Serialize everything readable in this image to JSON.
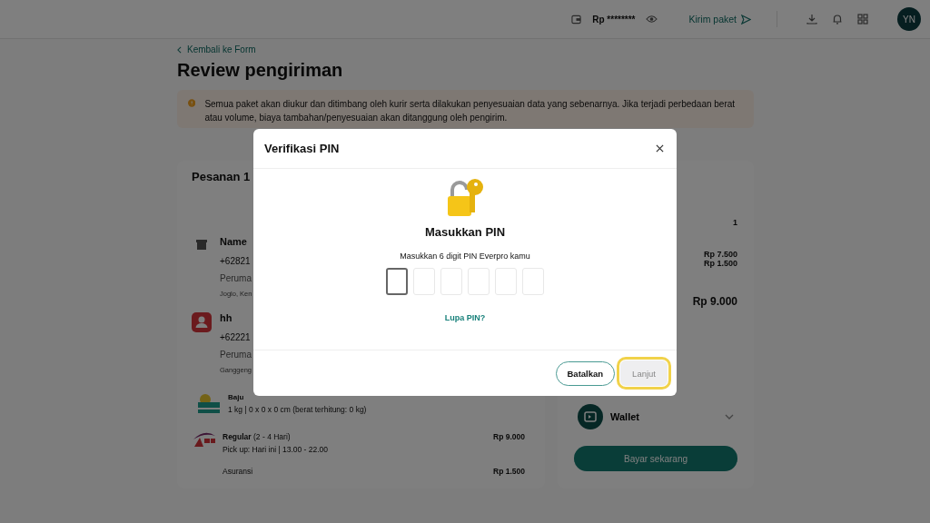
{
  "header": {
    "balance": "Rp ********",
    "send_button": "Kirim paket",
    "avatar": "YN"
  },
  "back_link": "Kembali ke Form",
  "page_title": "Review pengiriman",
  "notice": "Semua paket akan diukur dan ditimbang oleh kurir serta dilakukan penyesuaian data yang sebenarnya. Jika terjadi perbedaan berat atau volume, biaya tambahan/penyesuaian akan ditanggung oleh pengirim.",
  "order": {
    "title": "Pesanan 1",
    "sender": {
      "name": "Name",
      "phone": "+62821",
      "address": "Peruma",
      "area": "Joglo, Ken"
    },
    "receiver": {
      "name": "hh",
      "phone": "+62221",
      "address": "Peruma",
      "area": "Ganggeng"
    },
    "item": {
      "name": "Baju",
      "detail": "1 kg | 0 x 0 x 0 cm (berat terhitung: 0 kg)"
    },
    "courier": {
      "service": "Regular",
      "duration": "(2 - 4 Hari)",
      "pickup": "Pick up: Hari ini | 13.00 - 22.00",
      "price": "Rp 9.000"
    },
    "insurance": {
      "label": "Asuransi",
      "price": "Rp 1.500"
    }
  },
  "summary": {
    "values": [
      "1",
      "Rp 7.500",
      "Rp 1.500"
    ],
    "total": "Rp 9.000",
    "payment_method": "Wallet",
    "pay_button": "Bayar sekarang"
  },
  "dialog": {
    "title": "Verifikasi PIN",
    "heading": "Masukkan PIN",
    "instruction": "Masukkan 6 digit PIN Everpro kamu",
    "pin_boxes": [
      {
        "focused": true
      },
      {
        "focused": false
      },
      {
        "focused": false
      },
      {
        "focused": false
      },
      {
        "focused": false
      },
      {
        "focused": false
      }
    ],
    "forgot_link": "Lupa PIN?",
    "cancel_button": "Batalkan",
    "next_button": {
      "label": "Lanjut",
      "disabled": true,
      "focused": true
    }
  }
}
